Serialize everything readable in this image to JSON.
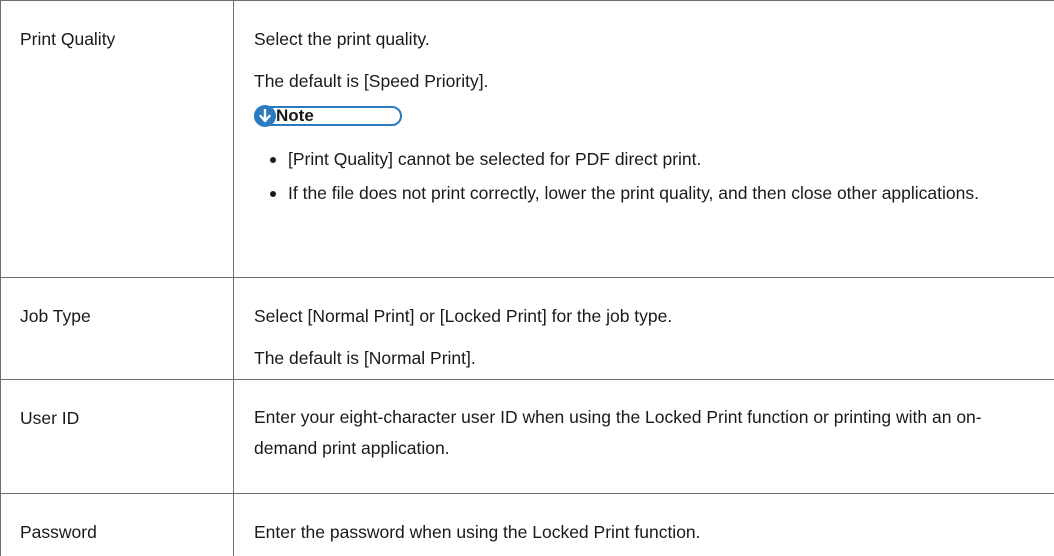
{
  "rows": [
    {
      "name": "Print Quality",
      "desc": [
        "Select the print quality.",
        "The default is [Speed Priority]."
      ],
      "note": {
        "label": "Note",
        "items": [
          "[Print Quality] cannot be selected for PDF direct print.",
          "If the file does not print correctly, lower the print quality, and then close other applications."
        ]
      }
    },
    {
      "name": "Job Type",
      "desc": [
        "Select [Normal Print] or [Locked Print] for the job type.",
        "The default is [Normal Print]."
      ]
    },
    {
      "name": "User ID",
      "desc": [
        "Enter your eight-character user ID when using the Locked Print function or printing with an on-demand print application."
      ]
    },
    {
      "name": "Password",
      "desc": [
        "Enter the password when using the Locked Print function."
      ]
    }
  ],
  "colors": {
    "note_accent": "#2a7bbf",
    "border": "#6e6e6e",
    "text": "#1a1a1a"
  },
  "icons": {
    "note": "down-arrow-circle-icon"
  }
}
